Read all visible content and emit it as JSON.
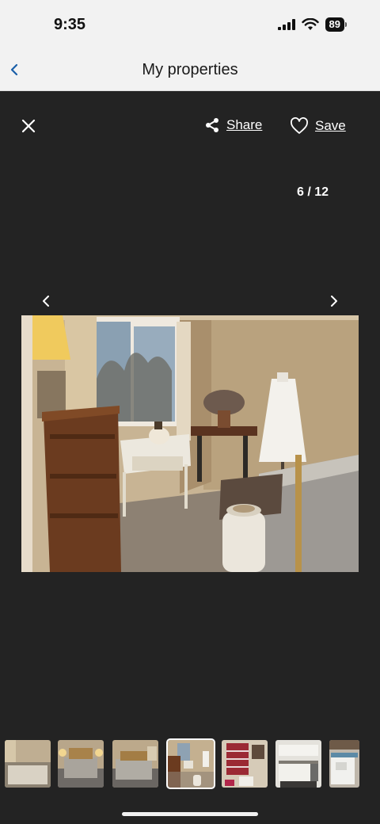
{
  "status_bar": {
    "time": "9:35",
    "battery": "89",
    "icons": [
      "signal-icon",
      "wifi-icon",
      "battery-icon"
    ]
  },
  "nav": {
    "title": "My properties",
    "back_icon": "chevron-left-icon"
  },
  "viewer": {
    "close_icon": "close-icon",
    "share_label": "Share",
    "save_label": "Save",
    "counter": "6 / 12",
    "prev_icon": "chevron-left-icon",
    "next_icon": "chevron-right-icon",
    "photo": "bedroom with dresser, lamp, window, white side table, sewing machine table, dress form and quilted bed"
  },
  "thumbnails": [
    {
      "subject": "bedroom with bed",
      "selected": false
    },
    {
      "subject": "bedroom with brass bed",
      "selected": false
    },
    {
      "subject": "bedroom with brass bed",
      "selected": false
    },
    {
      "subject": "bedroom with dresser and window",
      "selected": true
    },
    {
      "subject": "bathroom with red shower curtain",
      "selected": false
    },
    {
      "subject": "kitchen",
      "selected": false
    },
    {
      "subject": "laundry room",
      "selected": false
    }
  ],
  "colors": {
    "viewer_bg": "#232323",
    "chrome_bg": "#f2f2f2",
    "accent": "#1a5fa8"
  }
}
